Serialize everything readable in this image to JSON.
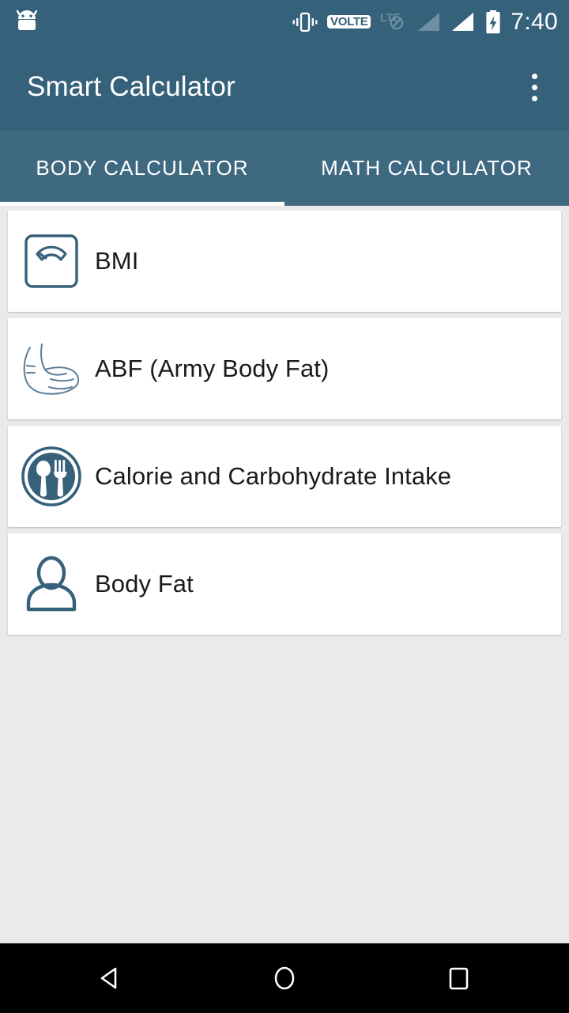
{
  "theme": {
    "primary": "#36617a",
    "tabbar": "#3f6881",
    "page_background": "#eaeaea",
    "card_background": "#ffffff",
    "icon_color": "#36617a",
    "text_color": "#1b1b1b",
    "navbar": "#000000"
  },
  "statusbar": {
    "left_icon": "android-logo-icon",
    "icons": [
      {
        "name": "vibrate-icon",
        "label": "Vibrate"
      },
      {
        "name": "volte-icon",
        "label": "VOLTE"
      },
      {
        "name": "lte-no-service-icon",
        "label": "LTE"
      },
      {
        "name": "signal-bars-sim1-icon",
        "label": "Signal 1"
      },
      {
        "name": "signal-bars-sim2-icon",
        "label": "Signal 2"
      },
      {
        "name": "battery-charging-icon",
        "label": "Battery charging"
      }
    ],
    "time": "7:40"
  },
  "toolbar": {
    "title": "Smart Calculator",
    "overflow_menu": "overflow-menu-icon"
  },
  "tabs": [
    {
      "label": "BODY CALCULATOR",
      "active": true
    },
    {
      "label": "MATH CALCULATOR",
      "active": false
    }
  ],
  "list": {
    "items": [
      {
        "label": "BMI",
        "icon": "weight-scale-icon"
      },
      {
        "label": "ABF (Army Body Fat)",
        "icon": "flexed-bicep-icon"
      },
      {
        "label": "Calorie and Carbohydrate Intake",
        "icon": "plate-cutlery-icon"
      },
      {
        "label": "Body Fat",
        "icon": "person-silhouette-icon"
      }
    ]
  },
  "navbar": {
    "buttons": [
      {
        "name": "back-button",
        "label": "Back"
      },
      {
        "name": "home-button",
        "label": "Home"
      },
      {
        "name": "recents-button",
        "label": "Recents"
      }
    ]
  }
}
